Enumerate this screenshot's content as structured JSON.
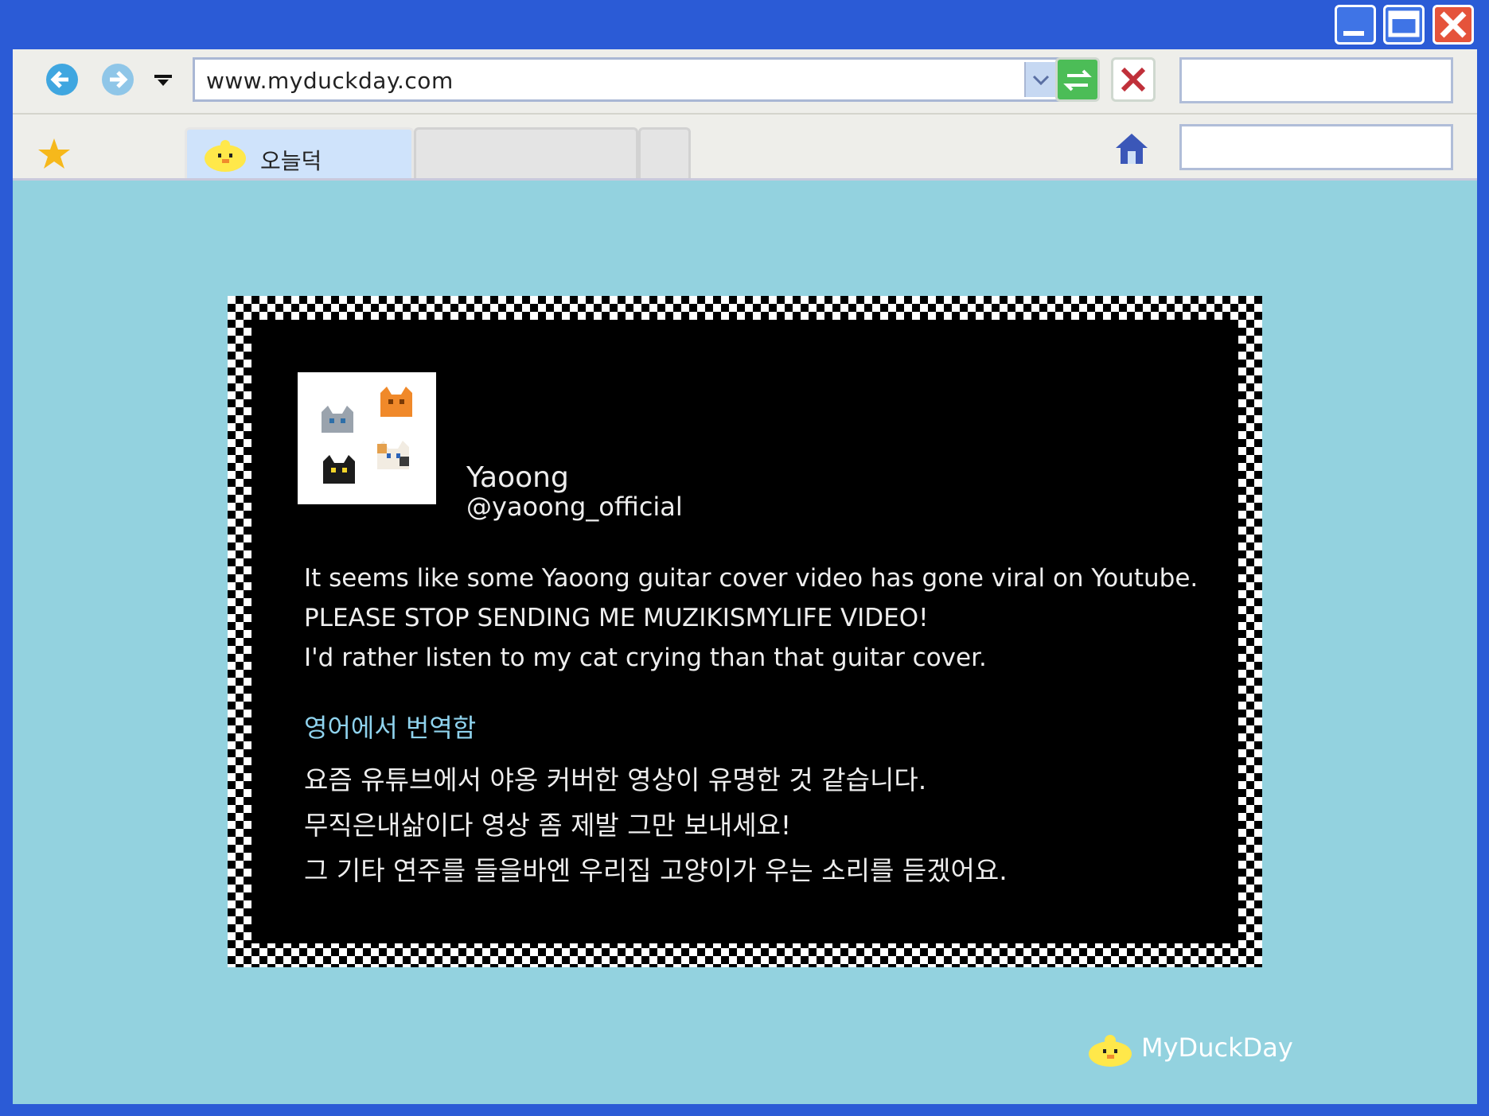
{
  "browser": {
    "address_url": "www.myduckday.com",
    "active_tab_label": "오늘덕"
  },
  "post": {
    "user_name": "Yaoong",
    "user_handle": "@yaoong_official",
    "lines": [
      "It seems like some Yaoong guitar cover video has gone viral on Youtube.",
      "PLEASE STOP SENDING ME MUZIKISMYLIFE VIDEO!",
      "I'd rather listen to my cat crying than that guitar cover."
    ],
    "translate_label": "영어에서 번역함",
    "translated_lines": [
      "요즘 유튜브에서 야옹 커버한 영상이 유명한 것 같습니다.",
      "무직은내삶이다 영상 좀 제발 그만 보내세요!",
      "그 기타 연주를 들을바엔 우리집 고양이가 우는 소리를 듣겠어요."
    ]
  },
  "brand": {
    "label": "MyDuckDay"
  },
  "icons": [
    "minimize-icon",
    "maximize-icon",
    "close-icon",
    "back-arrow-icon",
    "forward-arrow-icon",
    "dropdown-icon",
    "refresh-icon",
    "stop-icon",
    "star-icon",
    "duck-icon",
    "home-icon",
    "cats-avatar"
  ],
  "colors": {
    "title_bar": "#2b5bd6",
    "page_bg": "#93d2df",
    "card_bg": "#000000",
    "translate_link": "#8fd3ee",
    "accent_duck": "#ffe84a"
  }
}
